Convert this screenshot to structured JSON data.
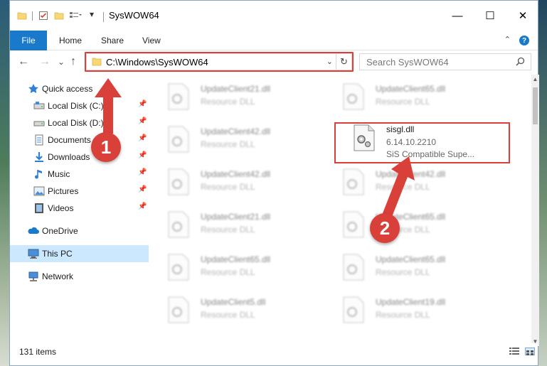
{
  "window": {
    "title": "SysWOW64",
    "controls": {
      "minimize": "—",
      "maximize": "☐",
      "close": "✕"
    }
  },
  "ribbon": {
    "tabs": [
      "File",
      "Home",
      "Share",
      "View"
    ],
    "help": "?",
    "collapse": "⌃"
  },
  "addressbar": {
    "path": "C:\\Windows\\SysWOW64",
    "dropdown": "⌄",
    "refresh": "↻",
    "search_placeholder": "Search SysWOW64",
    "search_icon": "search-icon"
  },
  "nav": {
    "back": "←",
    "forward": "→",
    "recent": "⌄",
    "up": "↑"
  },
  "sidebar": {
    "items": [
      {
        "label": "Quick access",
        "icon": "star-icon"
      },
      {
        "label": "Local Disk (C:)",
        "icon": "drive-icon",
        "pinned": true
      },
      {
        "label": "Local Disk (D:)",
        "icon": "drive-icon",
        "pinned": true
      },
      {
        "label": "Documents",
        "icon": "documents-icon",
        "pinned": true
      },
      {
        "label": "Downloads",
        "icon": "downloads-icon",
        "pinned": true
      },
      {
        "label": "Music",
        "icon": "music-icon",
        "pinned": true
      },
      {
        "label": "Pictures",
        "icon": "pictures-icon",
        "pinned": true
      },
      {
        "label": "Videos",
        "icon": "videos-icon",
        "pinned": true
      },
      {
        "label": "OneDrive",
        "icon": "cloud-icon"
      },
      {
        "label": "This PC",
        "icon": "computer-icon",
        "selected": true
      },
      {
        "label": "Network",
        "icon": "network-icon"
      }
    ],
    "pin_glyph": "📌"
  },
  "files": [
    {
      "name": "UpdateClient21.dll",
      "desc": "Resource DLL"
    },
    {
      "name": "UpdateClient65.dll",
      "desc": "Resource DLL"
    },
    {
      "name": "UpdateClient42.dll",
      "desc": "Resource DLL"
    },
    {
      "name": "sisgl.dll",
      "version": "6.14.10.2210",
      "desc": "SiS Compatible Supe..."
    },
    {
      "name": "UpdateClient42.dll",
      "desc": "Resource DLL"
    },
    {
      "name": "UpdateClient42.dll",
      "desc": "Resource DLL"
    },
    {
      "name": "UpdateClient21.dll",
      "desc": "Resource DLL"
    },
    {
      "name": "UpdateClient65.dll",
      "desc": "Resource DLL"
    },
    {
      "name": "UpdateClient65.dll",
      "desc": "Resource DLL"
    },
    {
      "name": "UpdateClient65.dll",
      "desc": "Resource DLL"
    },
    {
      "name": "UpdateClient5.dll",
      "desc": "Resource DLL"
    },
    {
      "name": "UpdateClient19.dll",
      "desc": "Resource DLL"
    }
  ],
  "status": {
    "count": "131 items"
  },
  "annotations": {
    "step1": "1",
    "step2": "2"
  },
  "colors": {
    "accent": "#1979ca",
    "highlight": "#d9403a",
    "selected": "#cce8ff"
  }
}
